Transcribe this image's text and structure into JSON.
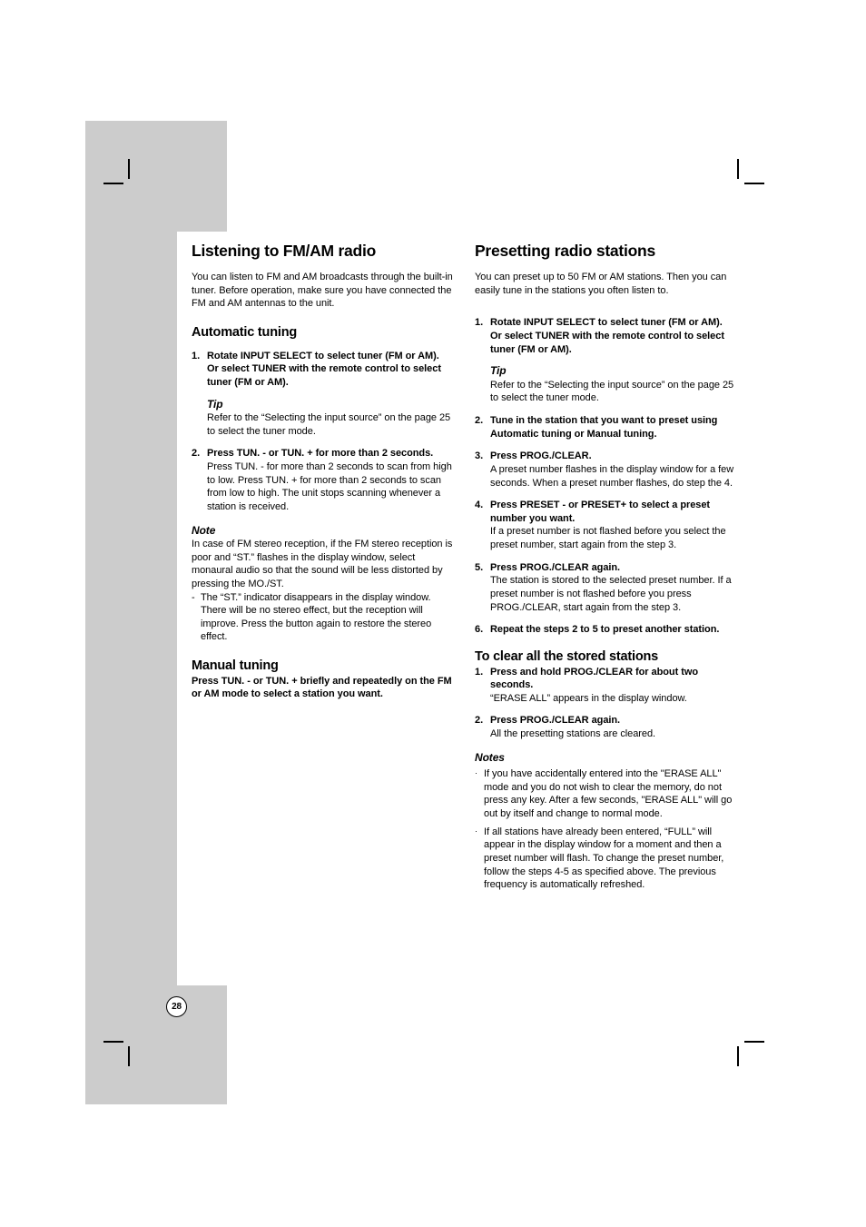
{
  "page": {
    "number": "28"
  },
  "left_column": {
    "title": "Listening to FM/AM radio",
    "intro": "You can listen to FM and AM broadcasts through the built-in tuner. Before operation, make sure you have connected the FM and AM antennas to the unit.",
    "automatic_tuning": {
      "heading": "Automatic tuning",
      "step1": {
        "num": "1.",
        "lead": "Rotate INPUT SELECT to select tuner (FM or AM). Or select TUNER with the remote control to select tuner (FM or AM).",
        "tip_heading": "Tip",
        "tip_text": "Refer to the “Selecting the input source” on the page 25 to select the tuner mode."
      },
      "step2": {
        "num": "2.",
        "lead": "Press TUN. - or TUN. + for more than 2 seconds.",
        "desc": "Press TUN. - for more than 2 seconds to scan from high to low. Press TUN. + for more than 2 seconds to scan from low to high. The unit stops scanning whenever a station is received."
      }
    },
    "note": {
      "heading": "Note",
      "text": "In case of FM stereo reception, if the FM stereo reception is poor and “ST.” flashes in the display window, select monaural audio so that the sound will be less distorted by pressing the MO./ST.",
      "dash_mark": "-",
      "dash_text": "The “ST.” indicator disappears in the display window. There will be no stereo effect, but the reception will improve. Press the button again to restore the stereo effect."
    },
    "manual_tuning": {
      "heading": "Manual tuning",
      "text": "Press TUN. - or TUN. + briefly and repeatedly on the FM or AM mode to select a station you want."
    }
  },
  "right_column": {
    "title": "Presetting radio stations",
    "intro": "You can preset up to 50 FM or AM stations. Then you can easily tune in the stations you often listen to.",
    "steps": [
      {
        "num": "1.",
        "lead": "Rotate INPUT SELECT to select tuner (FM or AM). Or select TUNER with the remote control to select tuner (FM or AM).",
        "tip_heading": "Tip",
        "tip_text": "Refer to the “Selecting the input source” on the page 25 to select the tuner mode.",
        "desc": ""
      },
      {
        "num": "2.",
        "lead": "Tune in the station that you want to preset using Automatic tuning or Manual tuning.",
        "desc": ""
      },
      {
        "num": "3.",
        "lead": "Press PROG./CLEAR.",
        "desc": "A preset number flashes in the display window for a few seconds. When a preset number flashes, do step the 4."
      },
      {
        "num": "4.",
        "lead": "Press PRESET - or PRESET+ to select a preset number you want.",
        "desc": "If a preset number is not flashed before you select the preset number, start again from the step 3."
      },
      {
        "num": "5.",
        "lead": "Press PROG./CLEAR again.",
        "desc": "The station is stored to the selected preset number. If a preset number is not flashed before you press PROG./CLEAR, start again from the step 3."
      },
      {
        "num": "6.",
        "lead": "Repeat the steps 2 to 5 to preset another station.",
        "desc": ""
      }
    ],
    "clear_section": {
      "heading": "To clear all the stored stations",
      "steps": [
        {
          "num": "1.",
          "lead": "Press and hold PROG./CLEAR for about two seconds.",
          "desc": "“ERASE ALL” appears in the display window."
        },
        {
          "num": "2.",
          "lead": "Press PROG./CLEAR again.",
          "desc": "All the presetting stations are cleared."
        }
      ],
      "notes_heading": "Notes",
      "notes": [
        "If you have accidentally entered into the \"ERASE ALL\" mode and you do not wish to clear the memory, do not press any key. After a few seconds, \"ERASE ALL\" will go out by itself and change to normal mode.",
        "If all stations have already been entered, “FULL” will appear in the display window for a moment and then a preset number will flash. To change the preset number, follow the steps 4-5 as specified above. The previous frequency is automatically refreshed."
      ],
      "bullet_mark": "·"
    }
  }
}
